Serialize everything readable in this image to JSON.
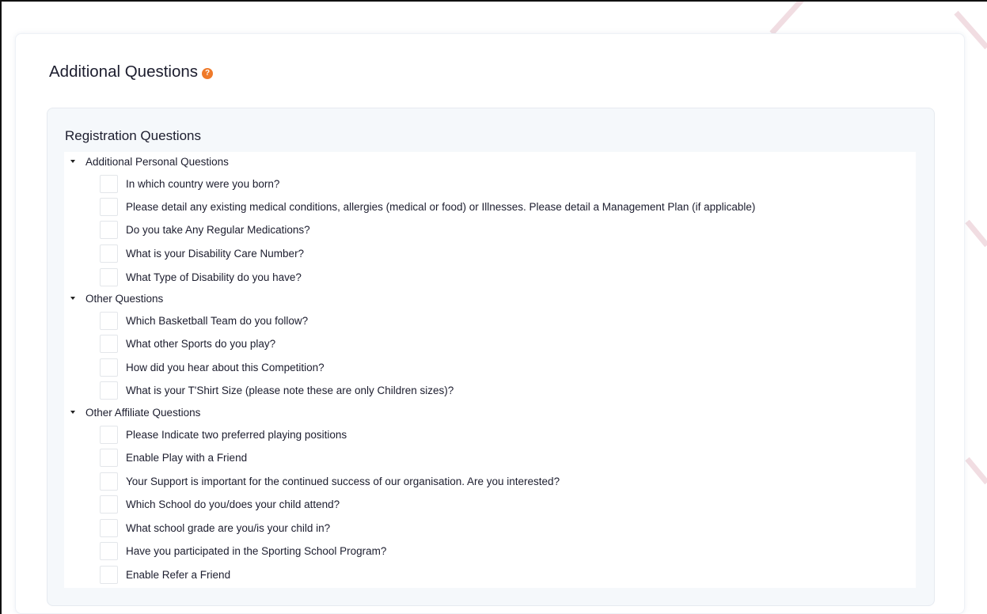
{
  "page": {
    "title": "Additional Questions",
    "help_icon": "question-circle-icon",
    "accent_color": "#ef7a2a"
  },
  "panel": {
    "title": "Registration Questions"
  },
  "groups": [
    {
      "label": "Additional Personal Questions",
      "questions": [
        "In which country were you born?",
        "Please detail any existing medical conditions, allergies (medical or food) or Illnesses. Please detail a Management Plan (if applicable)",
        "Do you take Any Regular Medications?",
        "What is your Disability Care Number?",
        "What Type of Disability do you have?"
      ]
    },
    {
      "label": "Other Questions",
      "questions": [
        "Which Basketball Team do you follow?",
        "What other Sports do you play?",
        "How did you hear about this Competition?",
        "What is your T'Shirt Size (please note these are only Children sizes)?"
      ]
    },
    {
      "label": "Other Affiliate Questions",
      "questions": [
        "Please Indicate two preferred playing positions",
        "Enable Play with a Friend",
        "Your Support is important for the continued success of our organisation. Are you interested?",
        "Which School do you/does your child attend?",
        "What school grade are you/is your child in?",
        "Have you participated in the Sporting School Program?",
        "Enable Refer a Friend"
      ]
    }
  ]
}
